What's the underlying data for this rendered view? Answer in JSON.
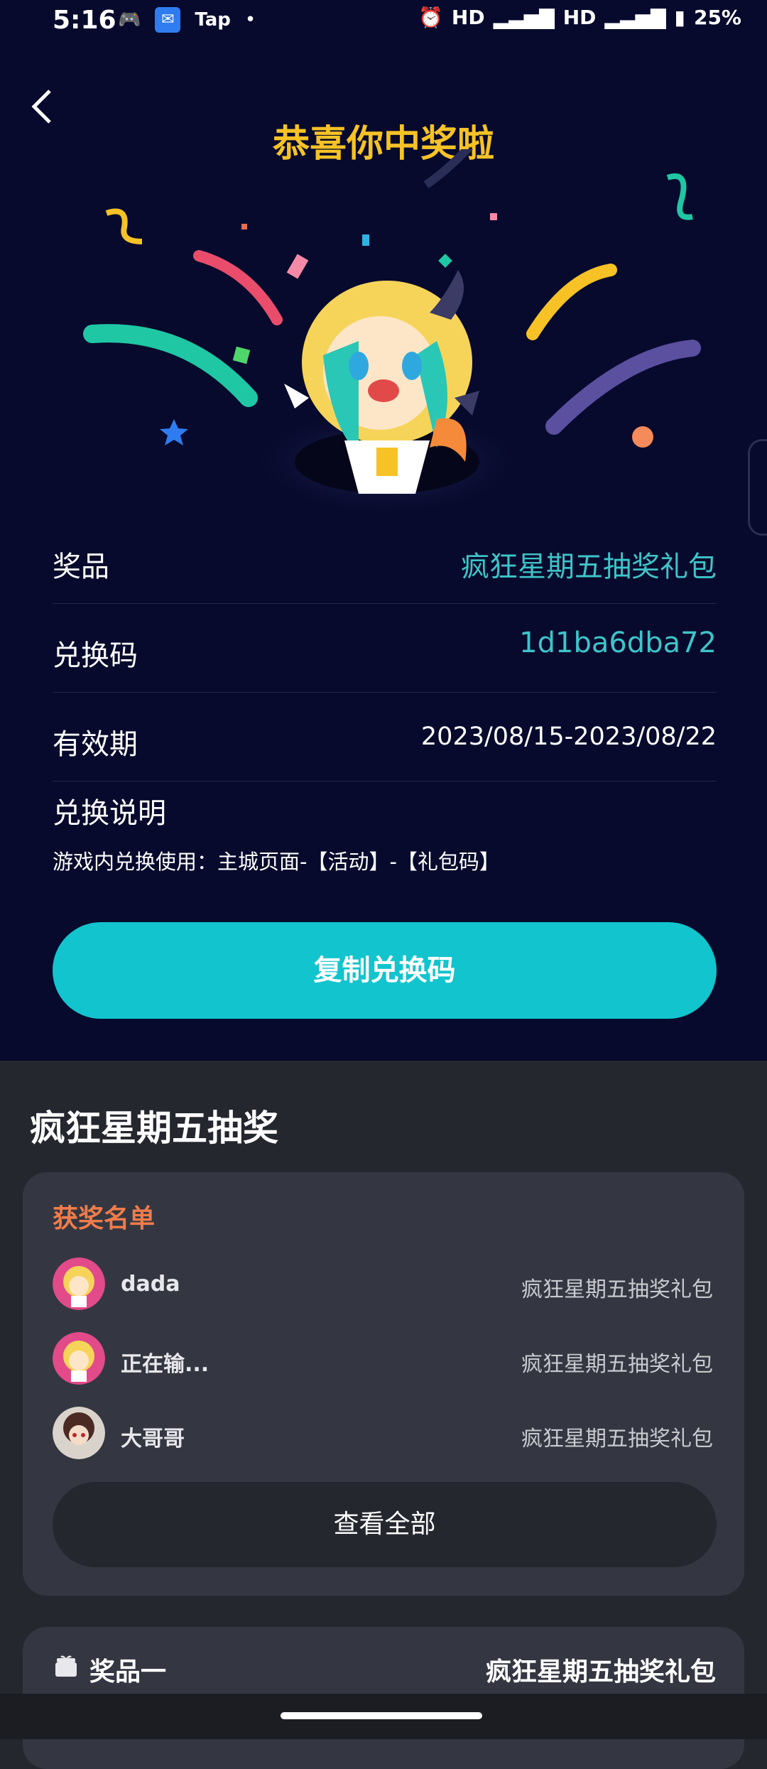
{
  "status_bar": {
    "time": "5:16",
    "app_tap": "Tap",
    "network_1": "HD",
    "network_2": "HD",
    "battery": "25%"
  },
  "header": {
    "title": "恭喜你中奖啦"
  },
  "prize_details": {
    "prize_label": "奖品",
    "prize_value": "疯狂星期五抽奖礼包",
    "code_label": "兑换码",
    "code_value": "1d1ba6dba72",
    "validity_label": "有效期",
    "validity_value": "2023/08/15-2023/08/22",
    "instructions_label": "兑换说明",
    "instructions_text": "游戏内兑换使用：主城页面-【活动】-【礼包码】"
  },
  "copy_button_label": "复制兑换码",
  "lottery": {
    "title": "疯狂星期五抽奖",
    "winners_title": "获奖名单",
    "winners": [
      {
        "name": "dada",
        "prize": "疯狂星期五抽奖礼包"
      },
      {
        "name": "正在输...",
        "prize": "疯狂星期五抽奖礼包"
      },
      {
        "name": "大哥哥",
        "prize": "疯狂星期五抽奖礼包"
      }
    ],
    "view_all_label": "查看全部",
    "prize_one_label": "奖品一",
    "prize_one_value": "疯狂星期五抽奖礼包"
  }
}
